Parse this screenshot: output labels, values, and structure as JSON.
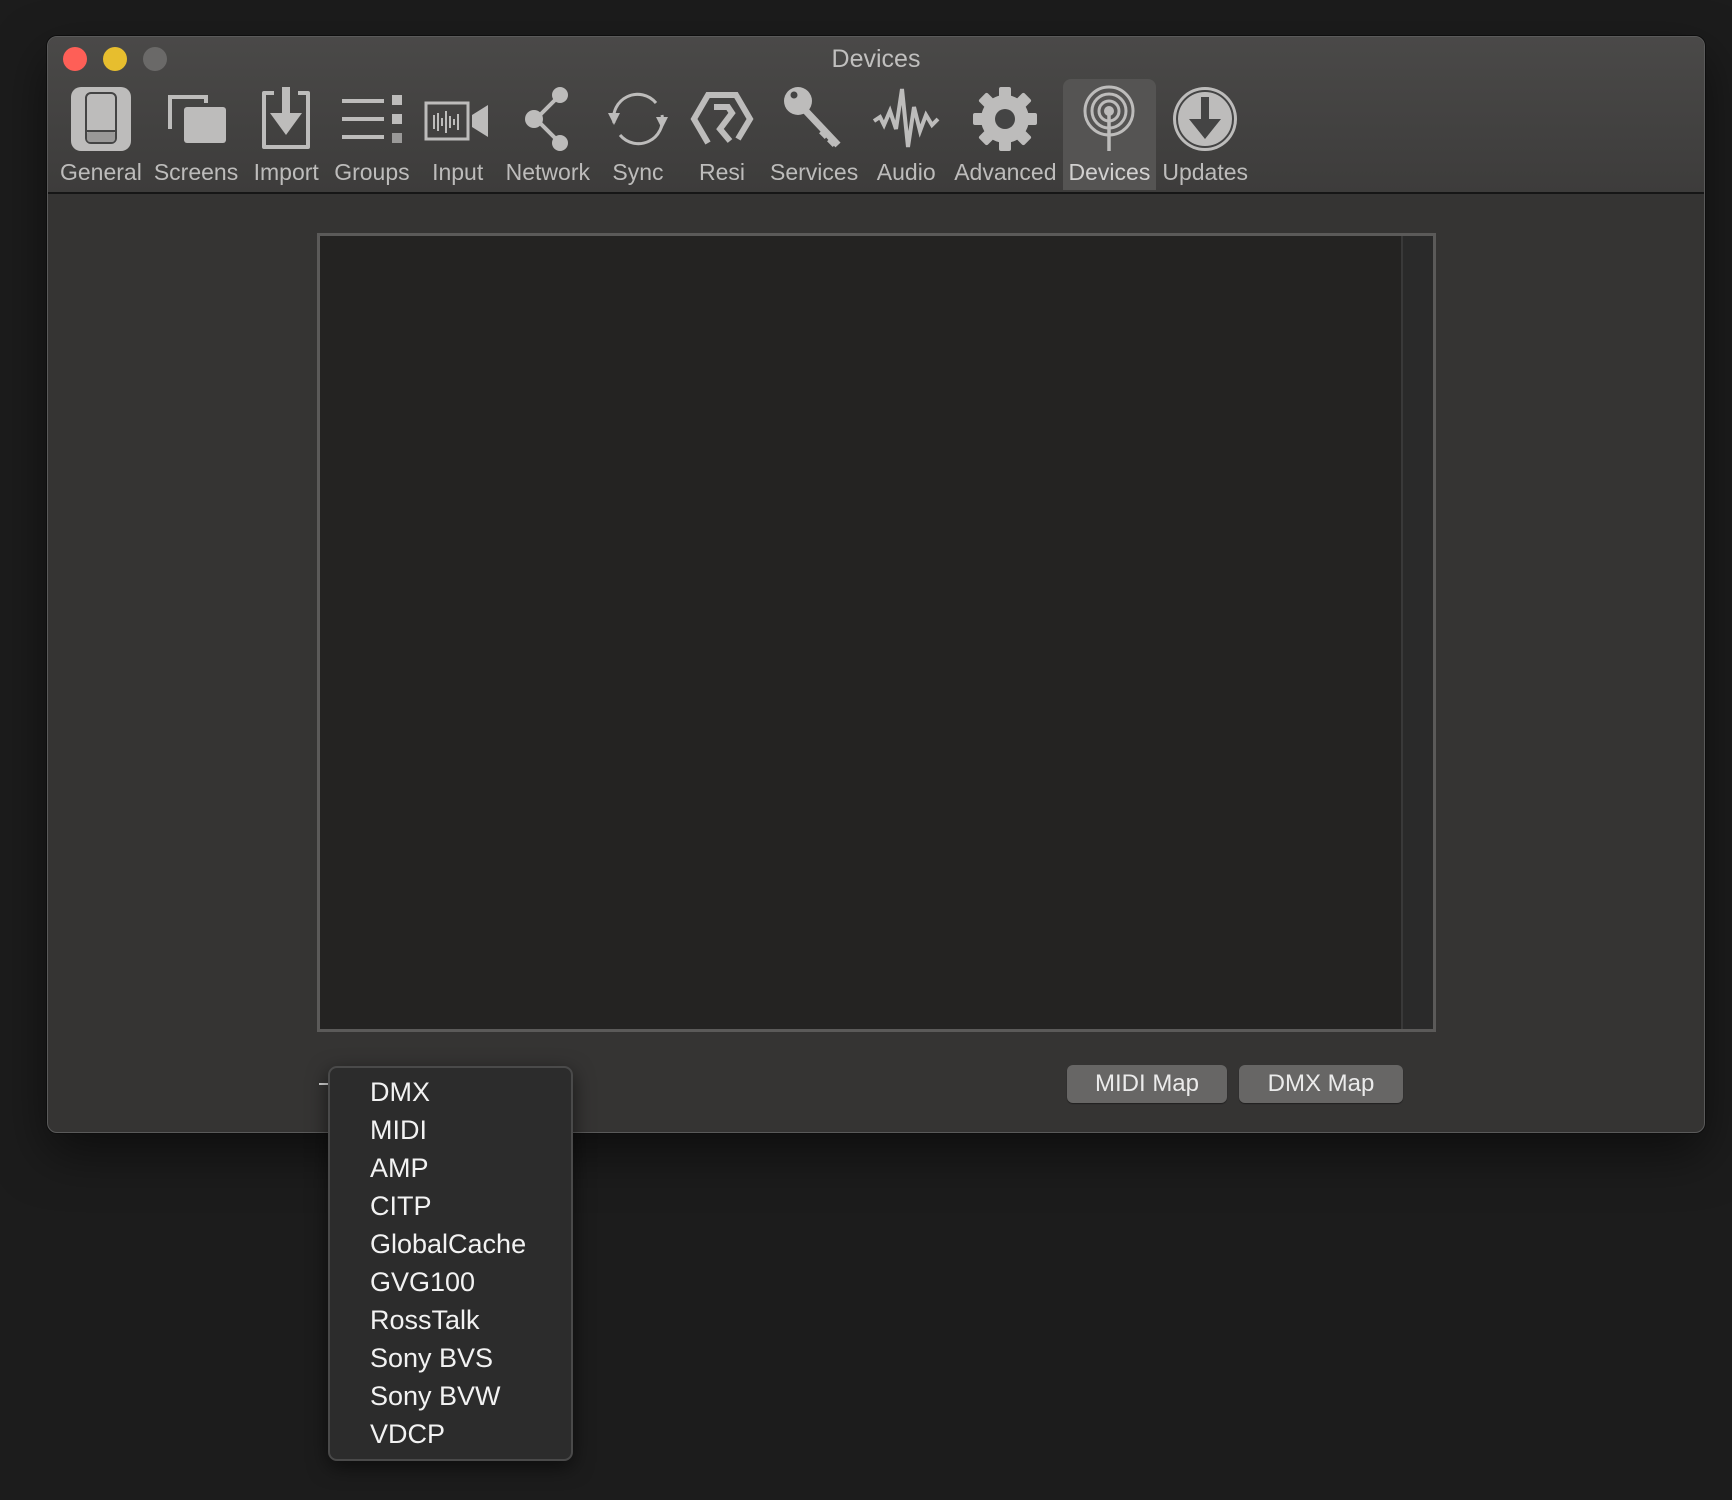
{
  "window": {
    "title": "Devices",
    "traffic_lights": {
      "close": "#fe5f57",
      "minimize": "#e7be2e",
      "zoom": "#6a6968"
    }
  },
  "toolbar": {
    "items": [
      {
        "label": "General",
        "icon": "general-icon",
        "selected": false
      },
      {
        "label": "Screens",
        "icon": "screens-icon",
        "selected": false
      },
      {
        "label": "Import",
        "icon": "import-icon",
        "selected": false
      },
      {
        "label": "Groups",
        "icon": "groups-icon",
        "selected": false
      },
      {
        "label": "Input",
        "icon": "input-icon",
        "selected": false
      },
      {
        "label": "Network",
        "icon": "network-icon",
        "selected": false
      },
      {
        "label": "Sync",
        "icon": "sync-icon",
        "selected": false
      },
      {
        "label": "Resi",
        "icon": "resi-icon",
        "selected": false
      },
      {
        "label": "Services",
        "icon": "key-icon",
        "selected": false
      },
      {
        "label": "Audio",
        "icon": "waveform-icon",
        "selected": false
      },
      {
        "label": "Advanced",
        "icon": "gear-icon",
        "selected": false
      },
      {
        "label": "Devices",
        "icon": "antenna-icon",
        "selected": true
      },
      {
        "label": "Updates",
        "icon": "download-circle-icon",
        "selected": false
      }
    ]
  },
  "devices_panel": {
    "devices": [],
    "buttons": {
      "midi_map": "MIDI Map",
      "dmx_map": "DMX Map"
    }
  },
  "add_device_menu": {
    "items": [
      "DMX",
      "MIDI",
      "AMP",
      "CITP",
      "GlobalCache",
      "GVG100",
      "RossTalk",
      "Sony BVS",
      "Sony BVW",
      "VDCP"
    ]
  }
}
